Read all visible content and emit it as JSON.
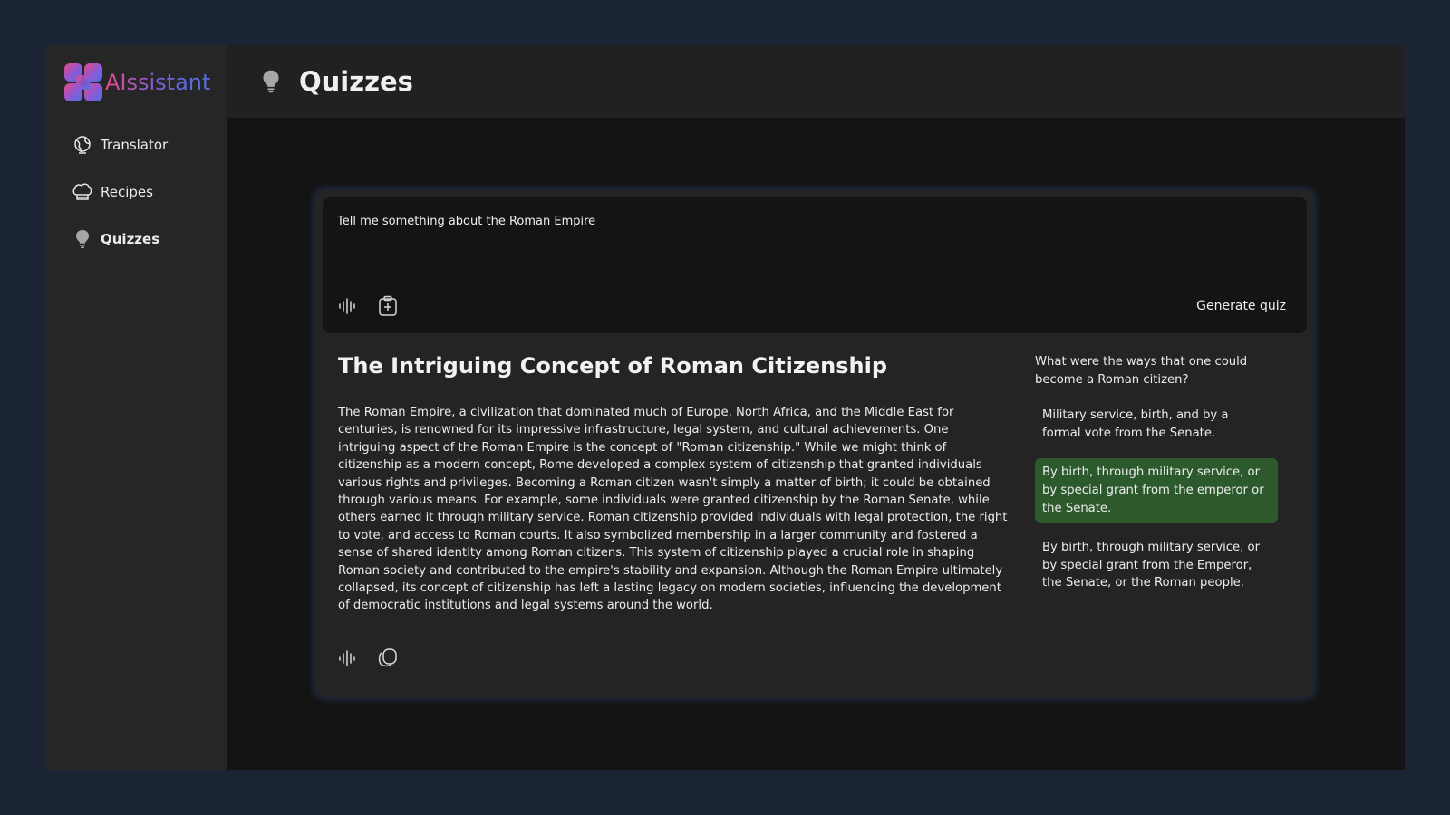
{
  "app": {
    "name": "AIssistant"
  },
  "sidebar": {
    "items": [
      {
        "label": "Translator",
        "icon": "translate-icon",
        "active": false
      },
      {
        "label": "Recipes",
        "icon": "chef-hat-icon",
        "active": false
      },
      {
        "label": "Quizzes",
        "icon": "lightbulb-icon",
        "active": true
      }
    ]
  },
  "header": {
    "title": "Quizzes",
    "icon": "lightbulb-icon"
  },
  "prompt": {
    "value": "Tell me something about the Roman Empire",
    "generate_label": "Generate quiz"
  },
  "article": {
    "title": "The Intriguing Concept of Roman Citizenship",
    "body": "The Roman Empire, a civilization that dominated much of Europe, North Africa, and the Middle East for centuries, is renowned for its impressive infrastructure, legal system, and cultural achievements. One intriguing aspect of the Roman Empire is the concept of \"Roman citizenship.\"  While we might think of citizenship as a modern concept, Rome developed a complex system of citizenship that granted individuals various rights and privileges.  Becoming a Roman citizen wasn't simply a matter of birth; it could be obtained through various means. For example, some individuals were granted citizenship by the Roman Senate, while others earned it through military service.  Roman citizenship provided individuals with legal protection, the right to vote, and access to Roman courts. It also symbolized membership in a larger community and fostered a sense of shared identity among Roman citizens.  This system of citizenship played a crucial role in shaping Roman society and contributed to the empire's stability and expansion.  Although the Roman Empire ultimately collapsed, its concept of citizenship has left a lasting legacy on modern societies, influencing the development of democratic institutions and legal systems around the world."
  },
  "quiz": {
    "question": "What were the ways that one could become a Roman citizen?",
    "options": [
      {
        "text": "Military service, birth, and by a formal vote from the Senate.",
        "state": "default"
      },
      {
        "text": "By birth, through military service, or by special grant from the emperor or the Senate.",
        "state": "correct"
      },
      {
        "text": "By birth, through military service, or by special grant from the Emperor, the Senate, or the Roman people.",
        "state": "default"
      }
    ]
  },
  "colors": {
    "page_bg": "#1b2433",
    "sidebar_bg": "#262626",
    "content_bg": "#141414",
    "card_bg": "#242424",
    "correct_bg": "#2c5a2c",
    "brand_gradient": [
      "#e8488a",
      "#7a5fd8",
      "#4b73e0"
    ]
  }
}
